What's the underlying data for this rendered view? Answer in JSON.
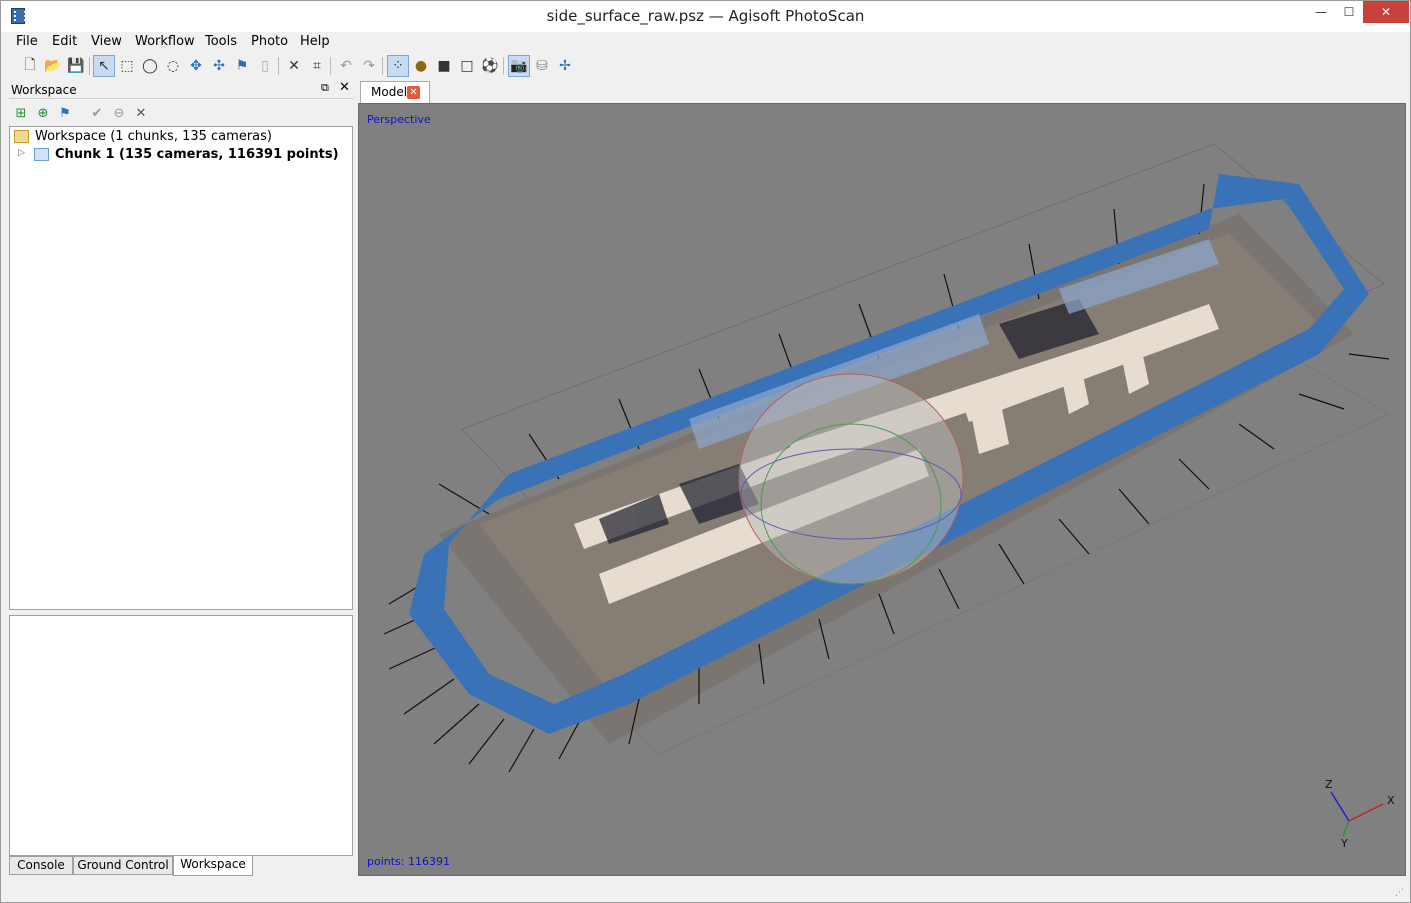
{
  "window": {
    "title": "side_surface_raw.psz — Agisoft PhotoScan",
    "minimize": "—",
    "maximize": "☐",
    "close": "✕"
  },
  "menu": [
    "File",
    "Edit",
    "View",
    "Workflow",
    "Tools",
    "Photo",
    "Help"
  ],
  "workspace_panel": {
    "title": "Workspace",
    "float_icon": "⧉",
    "close_icon": "✕",
    "root": "Workspace (1 chunks, 135 cameras)",
    "chunk": "Chunk 1 (135 cameras, 116391 points)"
  },
  "bottom_tabs": [
    "Console",
    "Ground Control",
    "Workspace"
  ],
  "selected_bottom_tab": "Workspace",
  "doc_tab": {
    "label": "Model",
    "close": "✕"
  },
  "viewport": {
    "projection": "Perspective",
    "status": "points: 116391",
    "axes": {
      "x": "X",
      "y": "Y",
      "z": "Z"
    }
  },
  "colors": {
    "camera_blue": "#3a72b8",
    "viewport_bg": "#808080",
    "label_blue": "#1010d0"
  }
}
